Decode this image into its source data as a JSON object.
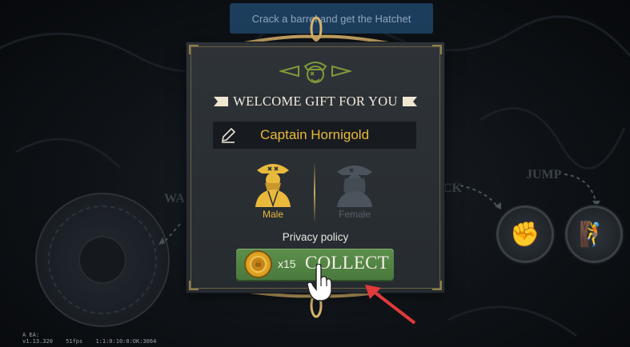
{
  "quest_banner": {
    "text": "Crack a barrel and get the Hatchet"
  },
  "controls": {
    "walk_label": "WA",
    "attack_label": "CK",
    "jump_label": "JUMP",
    "attack_icon": "fist-icon",
    "jump_icon": "climb-icon"
  },
  "modal": {
    "title": "WELCOME GIFT FOR YOU",
    "emblem_icon": "pirate-emblem-icon",
    "player_name": "Captain Hornigold",
    "edit_icon": "pencil-icon",
    "genders": [
      {
        "label": "Male",
        "selected": true
      },
      {
        "label": "Female",
        "selected": false
      }
    ],
    "privacy_label": "Privacy policy",
    "collect": {
      "coin_icon": "skull-coin-icon",
      "quantity": "x15",
      "label": "COLLECT"
    }
  },
  "debug": {
    "line1": "A EA:",
    "version": "v1.13.320",
    "fps": "51fps",
    "build": "1:1:0:10:0:OK:3064"
  },
  "colors": {
    "gold": "#e9b93c",
    "collect_green": "#4f8040",
    "panel": "#2b3035",
    "quest_blue": "#1d3d5c",
    "arrow_red": "#e03a3a"
  }
}
